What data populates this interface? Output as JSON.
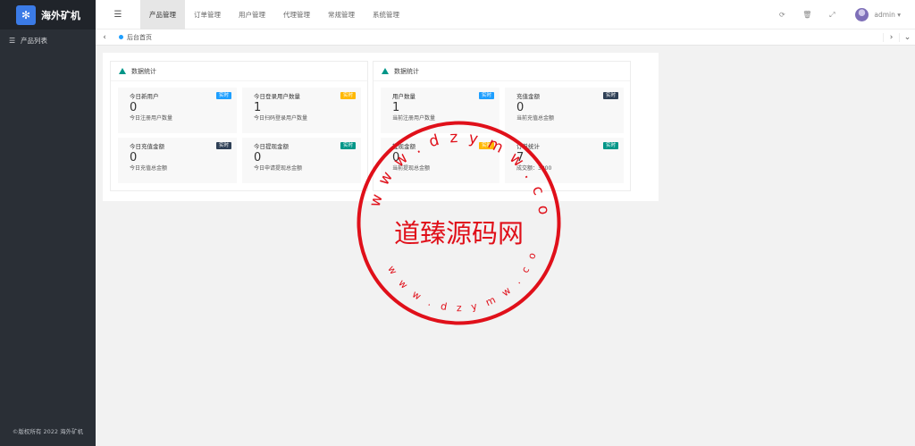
{
  "sidebar": {
    "logo_text": "海外矿机",
    "items": [
      {
        "label": "产品列表",
        "icon": "list-icon"
      }
    ],
    "copyright": "©版权所有 2022 海外矿机"
  },
  "header": {
    "menu_icon": "hamburger-icon",
    "nav": [
      "产品管理",
      "订单管理",
      "用户管理",
      "代理管理",
      "常规管理",
      "系统管理"
    ],
    "active_index": 0,
    "user": "admin"
  },
  "tabbar": {
    "home_label": "后台首页"
  },
  "cards": [
    {
      "title": "数据统计",
      "stats": [
        {
          "label": "今日新用户",
          "badge": "实时",
          "badge_color": "#1e9fff",
          "value": "0",
          "sub": "今日注册用户数量"
        },
        {
          "label": "今日登录用户数量",
          "badge": "实时",
          "badge_color": "#ffb800",
          "value": "1",
          "sub": "今日扫码登录用户数量"
        },
        {
          "label": "今日充值金额",
          "badge": "实时",
          "badge_color": "#2f4056",
          "value": "0",
          "sub": "今日充值总金额"
        },
        {
          "label": "今日提现金额",
          "badge": "实时",
          "badge_color": "#009688",
          "value": "0",
          "sub": "今日申请提现总金额"
        }
      ]
    },
    {
      "title": "数据统计",
      "stats": [
        {
          "label": "用户数量",
          "badge": "实时",
          "badge_color": "#1e9fff",
          "value": "1",
          "sub": "当前注册用户数量"
        },
        {
          "label": "充值金额",
          "badge": "实时",
          "badge_color": "#2f4056",
          "value": "0",
          "sub": "当前充值总金额"
        },
        {
          "label": "提现金额",
          "badge": "实时",
          "badge_color": "#ffb800",
          "value": "0",
          "sub": "当前提现总金额"
        },
        {
          "label": "订单统计",
          "badge": "实时",
          "badge_color": "#009688",
          "value": "7",
          "sub": "成交额：3800"
        }
      ]
    }
  ],
  "watermark": {
    "center_text": "道臻源码网",
    "ring_text": "w w w . d z y m w . c o m",
    "color": "#e0101a"
  }
}
